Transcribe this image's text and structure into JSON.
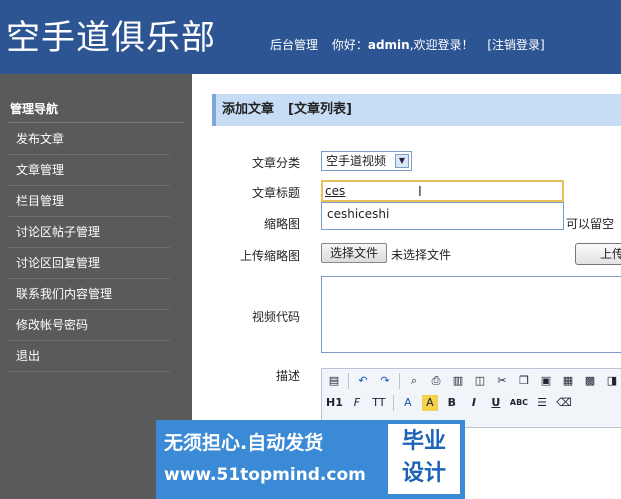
{
  "header": {
    "site_title": "空手道俱乐部",
    "admin_link": "后台管理",
    "greeting_prefix": "你好：",
    "username": "admin",
    "greeting_suffix": ",欢迎登录！",
    "logout_link": "[注销登录]"
  },
  "sidebar": {
    "heading": "管理导航",
    "items": [
      {
        "label": "发布文章"
      },
      {
        "label": "文章管理"
      },
      {
        "label": "栏目管理"
      },
      {
        "label": "讨论区帖子管理"
      },
      {
        "label": "讨论区回复管理"
      },
      {
        "label": "联系我们内容管理"
      },
      {
        "label": "修改帐号密码"
      },
      {
        "label": "退出"
      }
    ]
  },
  "main": {
    "title": "添加文章",
    "list_link": "[文章列表]"
  },
  "form": {
    "category_label": "文章分类",
    "category_value": "空手道视频",
    "title_label": "文章标题",
    "title_value": "ces",
    "autocomplete_suggestion": "ceshiceshi",
    "thumb_label": "缩略图",
    "thumb_hint": "可以留空",
    "upload_thumb_label": "上传缩略图",
    "choose_file_button": "选择文件",
    "no_file_text": "未选择文件",
    "upload_button": "上传",
    "video_label": "视频代码",
    "desc_label": "描述"
  },
  "editor_toolbar": {
    "row1": [
      "source-icon",
      "undo-icon",
      "redo-icon",
      "preview-icon",
      "print-icon",
      "template-icon",
      "code-icon",
      "cut-icon",
      "copy-icon",
      "paste-icon",
      "paste-text-icon",
      "paste-word-icon",
      "select-all-icon"
    ],
    "heading_label": "H1",
    "font_label": "F",
    "size_label": "TT",
    "forecolor_label": "A",
    "hilite_label": "A",
    "bold_label": "B",
    "italic_label": "I",
    "underline_label": "U",
    "strike_label": "ABC"
  },
  "watermark": {
    "line1": "无须担心.自动发货",
    "line2": "www.51topmind.com",
    "right_top": "毕业",
    "right_bottom": "设计"
  }
}
